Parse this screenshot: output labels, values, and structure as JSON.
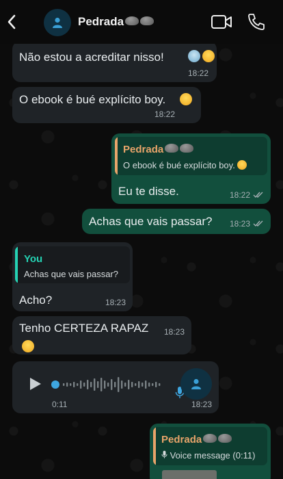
{
  "header": {
    "contact_name": "Pedrada",
    "icons": [
      "chevron-left-icon",
      "user-icon",
      "video-call-icon",
      "phone-icon"
    ]
  },
  "messages": [
    {
      "direction": "in",
      "text": "Não estou a acreditar nisso!",
      "time": "18:22"
    },
    {
      "direction": "in",
      "text": "O ebook é bué explícito boy.",
      "time": "18:22"
    },
    {
      "direction": "out",
      "quote_name": "Pedrada",
      "quote_text": "O ebook é bué explícito boy.",
      "text": "Eu te disse.",
      "time": "18:22"
    },
    {
      "direction": "out",
      "text": "Achas que vais passar?",
      "time": "18:23"
    },
    {
      "direction": "in",
      "quote_name": "You",
      "quote_text": "Achas que vais passar?",
      "text": "Acho?",
      "time": "18:23"
    },
    {
      "direction": "in",
      "text": "Tenho CERTEZA RAPAZ",
      "time": "18:23"
    },
    {
      "direction": "in",
      "type": "voice",
      "duration": "0:11",
      "time": "18:23"
    },
    {
      "direction": "out",
      "quote_name": "Pedrada",
      "quote_text": "Voice message (0:11)"
    }
  ],
  "colors": {
    "incoming_bubble": "#1f2327",
    "outgoing_bubble": "#124f3d",
    "quote_accent_orange": "#e8a46a",
    "quote_accent_teal": "#25d3b4",
    "ticks": "#a7b0b5"
  }
}
